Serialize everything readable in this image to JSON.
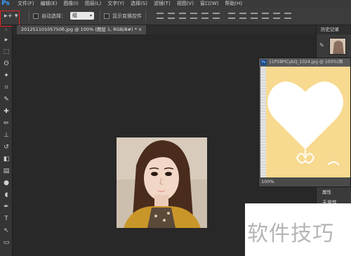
{
  "app": {
    "logo": "Ps"
  },
  "menu": [
    "文件(F)",
    "编辑(E)",
    "图像(I)",
    "图层(L)",
    "文字(Y)",
    "选择(S)",
    "滤镜(T)",
    "视图(V)",
    "窗口(W)",
    "帮助(H)"
  ],
  "options": {
    "tool_symbol": "▸+ ▾",
    "auto_select_label": "自动选择：",
    "auto_select_value": "组",
    "show_transform_label": "显示变换控件"
  },
  "document": {
    "tab_title": "20125110105750б.jpg @ 100% (图层 1, RGB/8#) *  ×"
  },
  "panels": {
    "history_title": "历史记录",
    "properties_title": "属性",
    "no_properties": "无属性"
  },
  "floating_window": {
    "title": "11P58PICybQ_1024.jpg @ 100%(图",
    "zoom": "100%"
  },
  "watermark": "软件技巧",
  "colors": {
    "accent_ps": "#3b9bff",
    "highlight_box": "#e02020",
    "floating_bg": "#f7d98f"
  }
}
